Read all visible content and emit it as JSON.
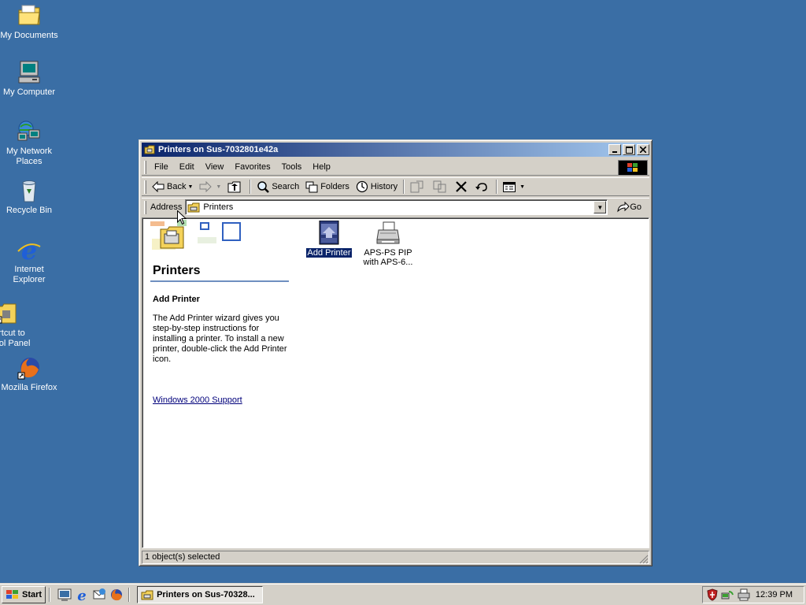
{
  "desktop": {
    "icons": [
      {
        "label": "My Documents"
      },
      {
        "label": "My Computer"
      },
      {
        "label": "My Network Places"
      },
      {
        "label": "Recycle Bin"
      },
      {
        "label": "Internet Explorer"
      },
      {
        "label": "ortcut to trol Panel"
      },
      {
        "label": "Mozilla Firefox"
      }
    ]
  },
  "window": {
    "title": "Printers on Sus-7032801e42a",
    "menu": [
      "File",
      "Edit",
      "View",
      "Favorites",
      "Tools",
      "Help"
    ],
    "toolbar": {
      "back": "Back",
      "search": "Search",
      "folders": "Folders",
      "history": "History"
    },
    "address": {
      "label": "Address",
      "value": "Printers",
      "go": "Go"
    },
    "left_pane": {
      "title": "Printers",
      "selected_name": "Add Printer",
      "selected_desc": "The Add Printer wizard gives you step-by-step instructions for installing a printer. To install a new printer, double-click the Add Printer icon.",
      "link": "Windows 2000 Support"
    },
    "items": [
      {
        "label": "Add Printer",
        "selected": true
      },
      {
        "label": "APS-PS PIP with APS-6...",
        "selected": false
      }
    ],
    "status": "1 object(s) selected"
  },
  "taskbar": {
    "start": "Start",
    "task": "Printers on Sus-70328...",
    "clock": "12:39 PM"
  }
}
